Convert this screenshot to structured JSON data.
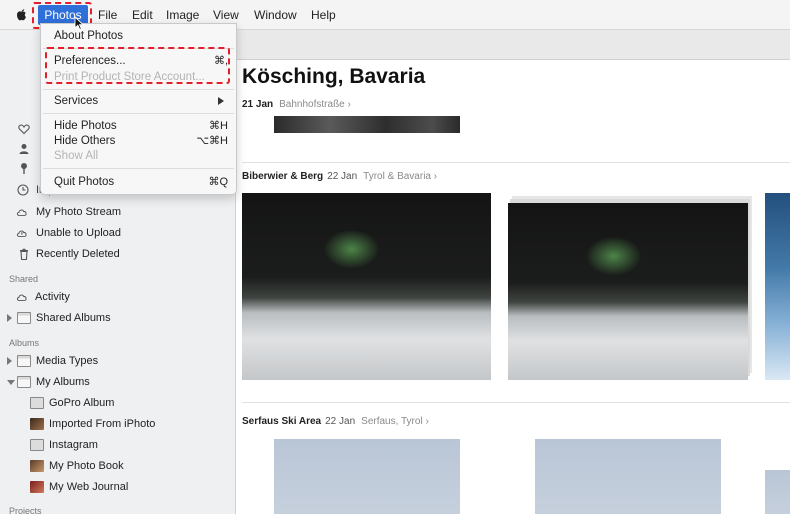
{
  "menubar": {
    "app_menu": "Photos",
    "items": [
      "File",
      "Edit",
      "Image",
      "View",
      "Window",
      "Help"
    ]
  },
  "dropdown": {
    "about": "About Photos",
    "preferences": "Preferences...",
    "preferences_shortcut": "⌘,",
    "print_store": "Print Product Store Account...",
    "services": "Services",
    "hide_photos": "Hide Photos",
    "hide_photos_shortcut": "⌘H",
    "hide_others": "Hide Others",
    "hide_others_shortcut": "⌥⌘H",
    "show_all": "Show All",
    "quit": "Quit Photos",
    "quit_shortcut": "⌘Q"
  },
  "sidebar": {
    "imports_partial": "Imports",
    "library_items": [
      "My Photo Stream",
      "Unable to Upload",
      "Recently Deleted"
    ],
    "shared_header": "Shared",
    "shared_items": [
      "Activity",
      "Shared Albums"
    ],
    "albums_header": "Albums",
    "album_groups": [
      "Media Types",
      "My Albums"
    ],
    "my_albums": [
      "GoPro Album",
      "Imported From iPhoto",
      "Instagram",
      "My Photo Book",
      "My Web Journal"
    ],
    "projects_header": "Projects"
  },
  "main": {
    "title": "Kösching, Bavaria",
    "moments": [
      {
        "title": "",
        "date": "21 Jan",
        "location": "Bahnhofstraße ›"
      },
      {
        "title": "Biberwier & Berg",
        "date": "22 Jan",
        "location": "Tyrol & Bavaria ›"
      },
      {
        "title": "Serfaus Ski Area",
        "date": "22 Jan",
        "location": "Serfaus, Tyrol ›"
      }
    ]
  },
  "colors": {
    "menu_highlight": "#2f6fd9",
    "annotation": "#e0202a",
    "sidebar_bg": "#eef0f2"
  }
}
